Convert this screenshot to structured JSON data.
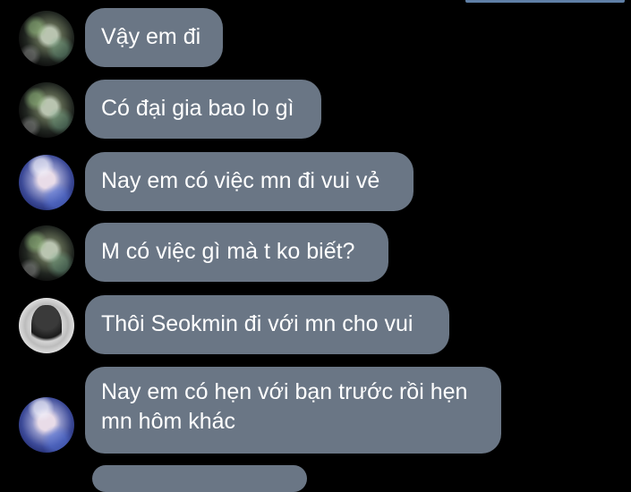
{
  "messages": [
    {
      "text": "Vậy em đi",
      "avatar_icon": "profile-photo-green-icon"
    },
    {
      "text": "Có đại gia bao lo gì",
      "avatar_icon": "profile-photo-green-icon"
    },
    {
      "text": "Nay em có việc mn đi vui vẻ",
      "avatar_icon": "profile-photo-blue-icon"
    },
    {
      "text": "M có việc gì mà t ko biết?",
      "avatar_icon": "profile-photo-green-icon"
    },
    {
      "text": "Thôi Seokmin đi với mn cho vui",
      "avatar_icon": "profile-photo-white-icon"
    },
    {
      "text": "Nay em có hẹn với bạn trước rồi hẹn mn hôm khác",
      "avatar_icon": "profile-photo-blue-icon"
    }
  ],
  "colors": {
    "background": "#000000",
    "bubble": "#6a7685",
    "text": "#ffffff",
    "top_accent": "#5f7fa6"
  }
}
